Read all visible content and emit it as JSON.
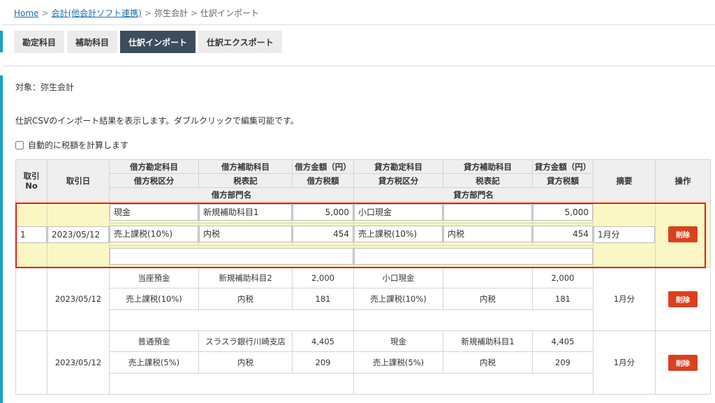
{
  "breadcrumb": {
    "home": "Home",
    "link1": "会計(他会計ソフト連携)",
    "item2": "弥生会計",
    "current": "仕訳インポート",
    "separator": ">"
  },
  "tabs": [
    {
      "label": "勘定科目"
    },
    {
      "label": "補助科目"
    },
    {
      "label": "仕訳インポート",
      "active": true
    },
    {
      "label": "仕訳エクスポート"
    }
  ],
  "target_label": "対象：弥生会計",
  "description": "仕訳CSVのインポート結果を表示します。ダブルクリックで編集可能です。",
  "auto_calc_label": "自動的に税額を計算します",
  "headers": {
    "no": "取引\nNo",
    "date": "取引日",
    "debit_account": "借方勘定科目",
    "debit_sub": "借方補助科目",
    "debit_amount": "借方金額（円）",
    "credit_account": "貸方勘定科目",
    "credit_sub": "貸方補助科目",
    "credit_amount": "貸方金額（円）",
    "memo": "摘要",
    "action": "操作",
    "debit_tax_class": "借方税区分",
    "debit_tax_note": "税表記",
    "debit_tax": "借方税額",
    "credit_tax_class": "貸方税区分",
    "credit_tax_note": "税表記",
    "credit_tax": "貸方税額",
    "debit_dept": "借方部門名",
    "credit_dept": "貸方部門名"
  },
  "edit_row": {
    "no": "1",
    "date": "2023/05/12",
    "debit_account": "現金",
    "debit_sub": "新規補助科目1",
    "debit_amount": "5,000",
    "credit_account": "小口現金",
    "credit_sub": "",
    "credit_amount": "5,000",
    "debit_tax_class": "売上課税(10%)",
    "debit_tax_note": "内税",
    "debit_tax": "454",
    "credit_tax_class": "売上課税(10%)",
    "credit_tax_note": "内税",
    "credit_tax": "454",
    "memo": "1月分",
    "debit_dept": "",
    "credit_dept": "",
    "delete_label": "削除"
  },
  "rows": [
    {
      "date": "2023/05/12",
      "debit_account": "当座預金",
      "debit_sub": "新規補助科目2",
      "debit_amount": "2,000",
      "credit_account": "小口現金",
      "credit_sub": "",
      "credit_amount": "2,000",
      "debit_tax_class": "売上課税(10%)",
      "debit_tax_note": "内税",
      "debit_tax": "181",
      "credit_tax_class": "売上課税(10%)",
      "credit_tax_note": "内税",
      "credit_tax": "181",
      "memo": "1月分",
      "delete_label": "削除"
    },
    {
      "date": "2023/05/12",
      "debit_account": "普通預金",
      "debit_sub": "スラスラ銀行川崎支店",
      "debit_amount": "4,405",
      "credit_account": "現金",
      "credit_sub": "新規補助科目1",
      "credit_amount": "4,405",
      "debit_tax_class": "売上課税(5%)",
      "debit_tax_note": "内税",
      "debit_tax": "209",
      "credit_tax_class": "売上課税(5%)",
      "credit_tax_note": "内税",
      "credit_tax": "209",
      "memo": "1月分",
      "delete_label": "削除"
    }
  ],
  "colors": {
    "accent": "#17a2c4",
    "active_tab": "#3d4d5e",
    "delete": "#d9411f",
    "highlight": "#e02020",
    "edit_bg": "#fbf7c4"
  }
}
